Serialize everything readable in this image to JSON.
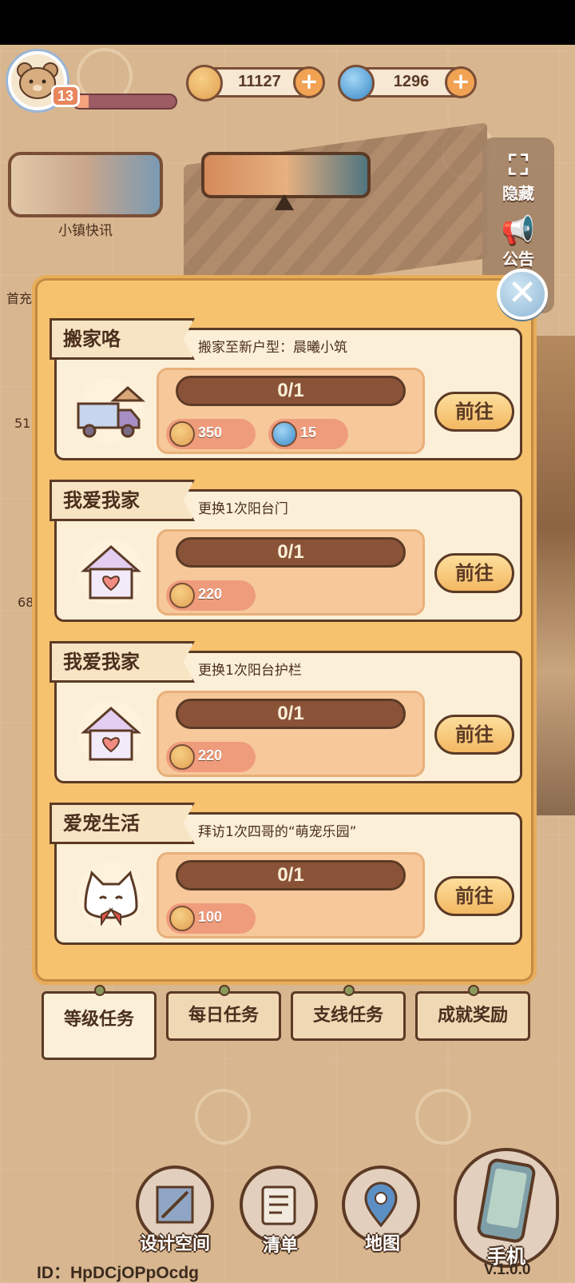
{
  "player": {
    "level": "13",
    "xp_progress": 0.15
  },
  "currencies": [
    {
      "name": "coins",
      "icon": "coin-icon",
      "value": "11127"
    },
    {
      "name": "gems",
      "icon": "swirl-gem-icon",
      "value": "1296"
    }
  ],
  "news": {
    "label": "小镇快讯"
  },
  "side_labels": [
    "首充",
    "51",
    "68"
  ],
  "right_panel": {
    "hide_label": "隐藏",
    "notice_label": "公告"
  },
  "tasks": [
    {
      "title": "搬家咯",
      "description": "搬家至新户型：晨曦小筑",
      "icon": "moving-truck-icon",
      "progress": "0/1",
      "rewards": [
        {
          "icon": "coin-icon",
          "value": "350"
        },
        {
          "icon": "swirl-gem-icon",
          "value": "15"
        }
      ],
      "button": "前往"
    },
    {
      "title": "我爱我家",
      "description": "更换1次阳台门",
      "icon": "heart-house-icon",
      "progress": "0/1",
      "rewards": [
        {
          "icon": "coin-icon",
          "value": "220"
        }
      ],
      "button": "前往"
    },
    {
      "title": "我爱我家",
      "description": "更换1次阳台护栏",
      "icon": "heart-house-icon",
      "progress": "0/1",
      "rewards": [
        {
          "icon": "coin-icon",
          "value": "220"
        }
      ],
      "button": "前往"
    },
    {
      "title": "爱宠生活",
      "description": "拜访1次四哥的“萌宠乐园”",
      "icon": "cat-bowtie-icon",
      "progress": "0/1",
      "rewards": [
        {
          "icon": "coin-icon",
          "value": "100"
        }
      ],
      "button": "前往"
    }
  ],
  "tabs": [
    "等级任务",
    "每日任务",
    "支线任务",
    "成就奖励"
  ],
  "active_tab": 0,
  "bottom_nav": [
    "设计空间",
    "清单",
    "地图",
    "手机"
  ],
  "footer": {
    "id": "ID：HpDCjOPpOcdg",
    "version": "V.1.0.0"
  },
  "colors": {
    "panel": "#f6c26e",
    "card": "#fcefd8",
    "button": "#f3b862",
    "outline": "#5b3a25"
  }
}
